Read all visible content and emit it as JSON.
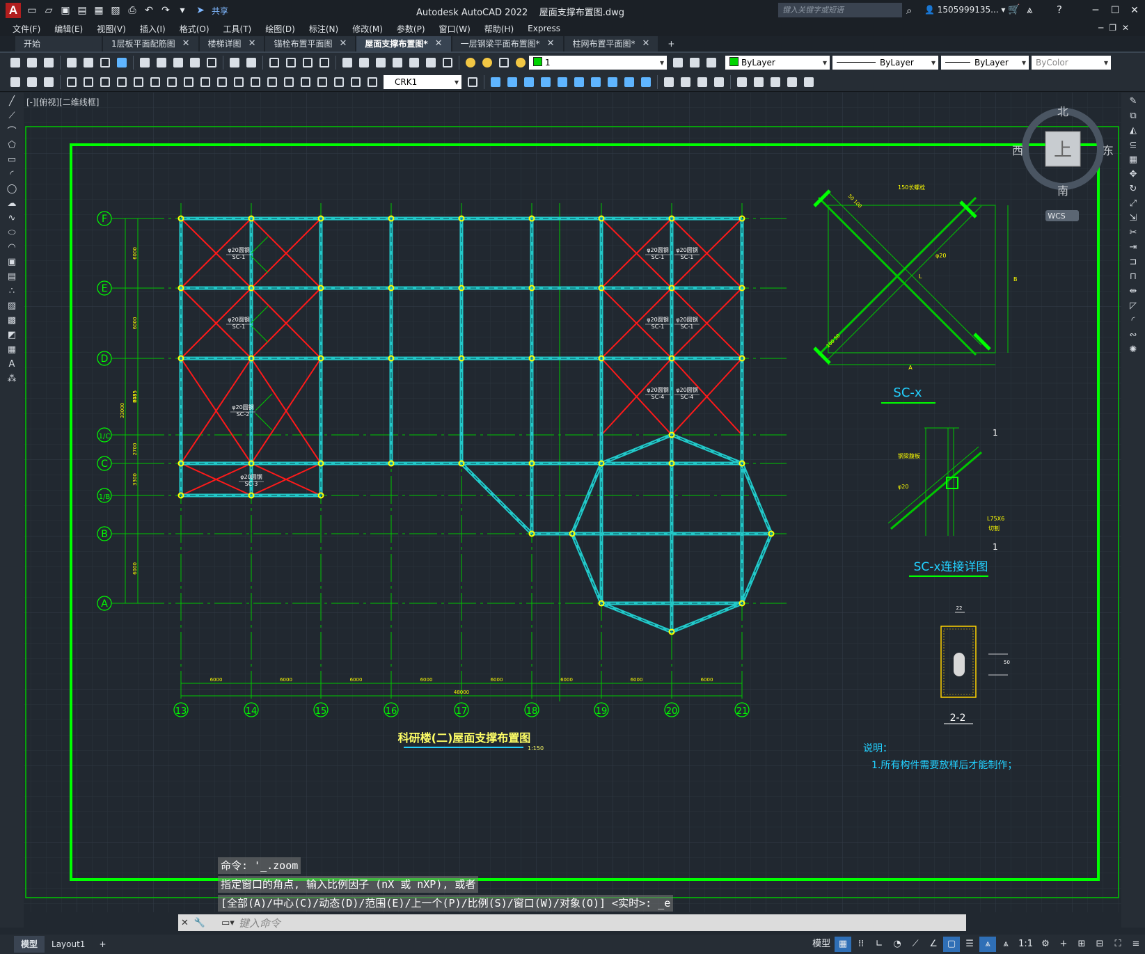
{
  "title_bar": {
    "app_title": "Autodesk AutoCAD 2022    屋面支撑布置图.dwg",
    "share_label": "共享",
    "search_placeholder": "键入关键字或短语",
    "user": "1505999135..."
  },
  "menu": [
    "文件(F)",
    "编辑(E)",
    "视图(V)",
    "插入(I)",
    "格式(O)",
    "工具(T)",
    "绘图(D)",
    "标注(N)",
    "修改(M)",
    "参数(P)",
    "窗口(W)",
    "帮助(H)",
    "Express"
  ],
  "tabs": [
    {
      "label": "开始",
      "closable": false,
      "active": false
    },
    {
      "label": "1层板平面配筋图",
      "closable": true,
      "active": false
    },
    {
      "label": "楼梯详图",
      "closable": true,
      "active": false
    },
    {
      "label": "锚栓布置平面图",
      "closable": true,
      "active": false
    },
    {
      "label": "屋面支撑布置图*",
      "closable": true,
      "active": true
    },
    {
      "label": "一层钢梁平面布置图*",
      "closable": true,
      "active": false
    },
    {
      "label": "柱网布置平面图*",
      "closable": true,
      "active": false
    }
  ],
  "properties": {
    "layer": "1",
    "color": "ByLayer",
    "linetype": "ByLayer",
    "lineweight": "ByLayer",
    "plotstyle": "ByColor",
    "textstyle": "CRK1"
  },
  "view_label": "[-][俯视][二维线框]",
  "viewcube": {
    "north": "北",
    "south": "南",
    "east": "东",
    "west": "西",
    "face": "上",
    "wcs": "WCS"
  },
  "drawing": {
    "title": "科研楼(二)屋面支撑布置图",
    "scale": "1:150",
    "row_axes": [
      "F",
      "E",
      "D",
      "1/C",
      "C",
      "1/B",
      "B",
      "A"
    ],
    "col_axes": [
      "13",
      "14",
      "15",
      "16",
      "17",
      "18",
      "19",
      "20",
      "21"
    ],
    "bay_dims": [
      "6000",
      "6000",
      "6000",
      "6000",
      "6000",
      "6000",
      "6000",
      "6000"
    ],
    "total_dim": "48000",
    "left_dims": [
      "6000",
      "6000",
      "6515",
      "2485",
      "2700",
      "3300",
      "6000"
    ],
    "left_total": "33000",
    "bracing_labels": [
      {
        "dia": "φ20圆钢",
        "code": "SC-1"
      },
      {
        "dia": "φ20圆钢",
        "code": "SC-1"
      },
      {
        "dia": "φ20圆钢",
        "code": "SC-2"
      },
      {
        "dia": "φ20圆钢",
        "code": "SC-3"
      },
      {
        "dia": "φ20圆钢",
        "code": "SC-1"
      },
      {
        "dia": "φ20圆钢",
        "code": "SC-1"
      },
      {
        "dia": "φ20圆钢",
        "code": "SC-1"
      },
      {
        "dia": "φ20圆钢",
        "code": "SC-1"
      },
      {
        "dia": "φ20圆钢",
        "code": "SC-4"
      },
      {
        "dia": "φ20圆钢",
        "code": "SC-4"
      }
    ],
    "detail_scx": {
      "title": "SC-x",
      "top_note": "150长螺栓",
      "dim_a": "A",
      "dim_b": "B",
      "rod": "φ20",
      "l": "L",
      "n1": "50 100",
      "n2": "100 50"
    },
    "detail_conn": {
      "title": "SC-x连接详图",
      "label1": "钢梁腹板",
      "rod": "φ20",
      "angle": "L75X6",
      "weld": "切割",
      "sec": "1"
    },
    "detail_22": {
      "title": "2-2",
      "dim_top": "22",
      "dim_side": "50"
    },
    "notes_title": "说明：",
    "notes": [
      "1.所有构件需要放样后才能制作；"
    ]
  },
  "command": {
    "history": [
      "命令: '_.zoom",
      "指定窗口的角点, 输入比例因子 (nX 或 nXP), 或者",
      "[全部(A)/中心(C)/动态(D)/范围(E)/上一个(P)/比例(S)/窗口(W)/对象(O)] <实时>: _e"
    ],
    "placeholder": "键入命令"
  },
  "layout_tabs": [
    "模型",
    "Layout1"
  ],
  "status": {
    "model_label": "模型",
    "scale": "1:1"
  },
  "colors": {
    "frame_green": "#00ff00",
    "axis_green": "#00c800",
    "steel_cyan": "#22c8c8",
    "brace_red": "#ff1a1a",
    "node_yellow": "#ffff00",
    "canvas": "#212830"
  }
}
